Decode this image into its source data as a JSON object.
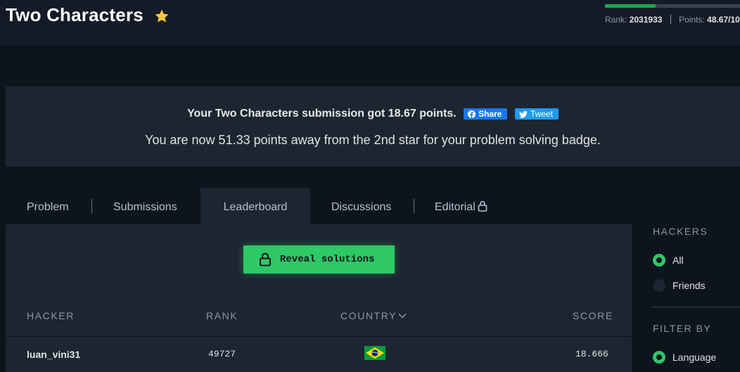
{
  "header": {
    "title": "Two Characters",
    "progress_fraction": 0.36,
    "rank_label": "Rank:",
    "rank_value": "2031933",
    "points_label": "Points:",
    "points_value": "48.67/10"
  },
  "banner": {
    "submission_message": "Your Two Characters submission got 18.67 points.",
    "share_label": "Share",
    "tweet_label": "Tweet",
    "badge_message": "You are now 51.33 points away from the 2nd star for your problem solving badge."
  },
  "tabs": [
    {
      "label": "Problem",
      "active": false
    },
    {
      "label": "Submissions",
      "active": false
    },
    {
      "label": "Leaderboard",
      "active": true
    },
    {
      "label": "Discussions",
      "active": false
    },
    {
      "label": "Editorial",
      "active": false
    }
  ],
  "leaderboard": {
    "reveal_label": "Reveal solutions",
    "columns": {
      "hacker": "HACKER",
      "rank": "RANK",
      "country": "COUNTRY",
      "score": "SCORE"
    },
    "rows": [
      {
        "hacker": "luan_vini31",
        "rank": "49727",
        "country_flag": "brazil-flag",
        "score": "18.666"
      }
    ]
  },
  "sidebar": {
    "hackers_heading": "HACKERS",
    "hackers_options": [
      {
        "label": "All",
        "selected": true
      },
      {
        "label": "Friends",
        "selected": false
      }
    ],
    "filter_heading": "FILTER BY",
    "filter_options": [
      {
        "label": "Language",
        "selected": true
      }
    ]
  },
  "colors": {
    "accent_green": "#2ec866",
    "background": "#0e141e",
    "panel": "#1d2531",
    "facebook_blue": "#1877f2",
    "twitter_blue": "#1d9bf0",
    "star_yellow": "#ffc53d"
  }
}
